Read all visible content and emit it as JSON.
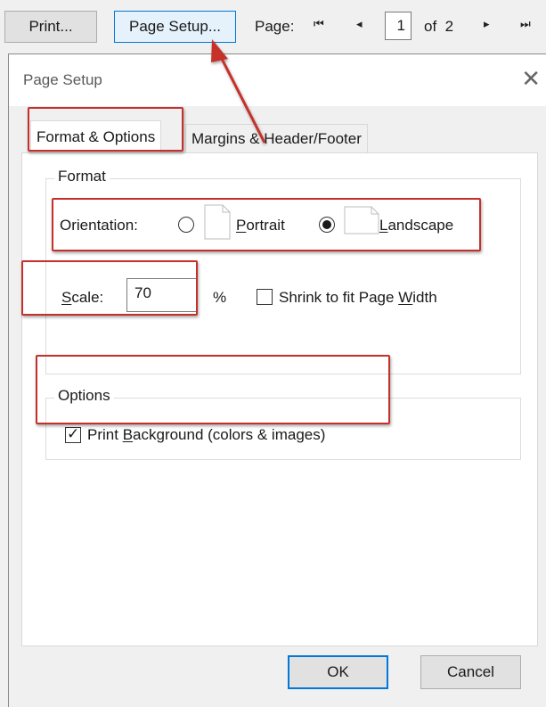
{
  "toolbar": {
    "print_label": "Print...",
    "page_setup_label": "Page Setup...",
    "page_label": "Page:",
    "current_page": "1",
    "of_label": "of",
    "total_pages": "2"
  },
  "dialog": {
    "title": "Page Setup",
    "tabs": [
      {
        "label": "Format & Options",
        "active": true
      },
      {
        "label": "Margins & Header/Footer",
        "active": false
      }
    ],
    "format_group": {
      "legend": "Format",
      "orientation_label": "Orientation:",
      "portrait_label": "Portrait",
      "landscape_label": "Landscape",
      "selected_orientation": "Landscape",
      "scale_label": "Scale:",
      "scale_value": "70",
      "percent_label": "%",
      "shrink_label": "Shrink to fit Page Width",
      "shrink_checked": false
    },
    "options_group": {
      "legend": "Options",
      "print_background_label": "Print Background (colors & images)",
      "print_background_checked": true
    },
    "ok_label": "OK",
    "cancel_label": "Cancel"
  },
  "colors": {
    "annotation_red": "#c4302b",
    "focus_blue": "#0078d7"
  }
}
